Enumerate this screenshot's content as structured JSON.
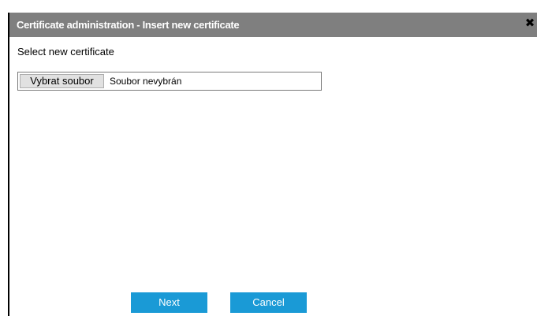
{
  "dialog": {
    "title": "Certificate administration - Insert new certificate",
    "close_glyph": "✖",
    "close_icon": "close-icon"
  },
  "form": {
    "label": "Select new certificate",
    "file_button_label": "Vybrat soubor",
    "file_status": "Soubor nevybrán"
  },
  "buttons": {
    "next_label": "Next",
    "cancel_label": "Cancel"
  },
  "colors": {
    "titlebar": "#7f7f7f",
    "button_accent": "#1a9ad6"
  }
}
